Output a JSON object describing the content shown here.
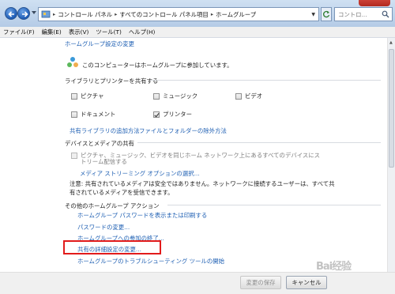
{
  "address": {
    "crumbs": [
      "コントロール パネル",
      "すべてのコントロール パネル項目",
      "ホームグループ"
    ],
    "search_placeholder": "コントロ..."
  },
  "menu": [
    "ファイル(F)",
    "編集(E)",
    "表示(V)",
    "ツール(T)",
    "ヘルプ(H)"
  ],
  "top_link": "ホームグループ設定の変更",
  "status": "このコンピューターはホームグループに参加しています。",
  "share_section": {
    "title": "ライブラリとプリンターを共有する",
    "items": [
      {
        "label": "ピクチャ",
        "checked": false
      },
      {
        "label": "ミュージック",
        "checked": false
      },
      {
        "label": "ビデオ",
        "checked": false
      },
      {
        "label": "ドキュメント",
        "checked": false
      },
      {
        "label": "プリンター",
        "checked": true
      }
    ],
    "link_libraries": "共有ライブラリの追加方法",
    "link_exclude": "ファイルとフォルダーの除外方法"
  },
  "media_section": {
    "title": "デバイスとメディアの共有",
    "stream_line1": "ピクチャ、ミュージック、ビデオを同じホーム ネットワーク上にあるすべてのデバイスにス",
    "stream_line2": "トリーム配信する",
    "stream_link": "メディア ストリーミング オプションの選択...",
    "note_line1": "注意: 共有されているメディアは安全ではありません。ネットワークに接続するユーザーは、すべて共",
    "note_line2": "有されているメディアを受信できます。"
  },
  "other_section": {
    "title": "その他のホームグループ アクション",
    "links": [
      "ホームグループ パスワードを表示または印刷する",
      "パスワードの変更...",
      "ホームグループへの参加の終了...",
      "共有の詳細設定の変更...",
      "ホームグループのトラブルシューティング ツールの開始"
    ]
  },
  "buttons": {
    "save": "変更の保存",
    "cancel": "キャンセル"
  },
  "watermark": "Bai经验"
}
